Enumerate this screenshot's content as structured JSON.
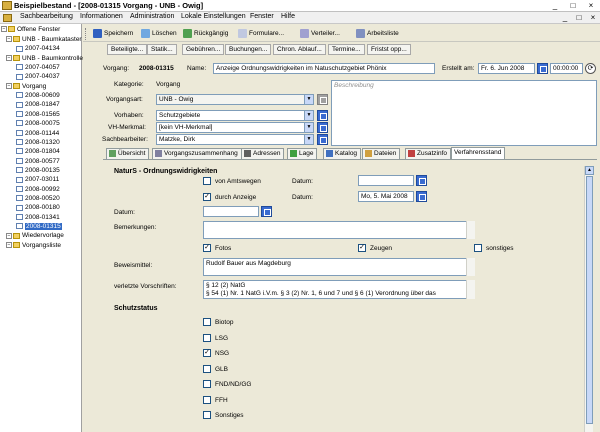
{
  "window": {
    "title": "Beispielbestand - [2008-01315 Vorgang - UNB - Owig]",
    "controls": [
      "_",
      "□",
      "×"
    ]
  },
  "menu": [
    "Sachbearbeitung",
    "Informationen",
    "Administration",
    "Lokale Einstellungen",
    "Fenster",
    "Hilfe"
  ],
  "tree": {
    "root": "Offene Fenster",
    "items": [
      {
        "label": "UNB - Baumkataster",
        "level": 1
      },
      {
        "label": "2007-04134",
        "level": 2
      },
      {
        "label": "UNB - Baumkontrolle",
        "level": 1
      },
      {
        "label": "2007-04057",
        "level": 2
      },
      {
        "label": "2007-04037",
        "level": 2
      },
      {
        "label": "Vorgang",
        "level": 1
      },
      {
        "label": "2008-00609",
        "level": 2
      },
      {
        "label": "2008-01847",
        "level": 2
      },
      {
        "label": "2008-01565",
        "level": 2
      },
      {
        "label": "2008-00075",
        "level": 2
      },
      {
        "label": "2008-01144",
        "level": 2
      },
      {
        "label": "2008-01320",
        "level": 2
      },
      {
        "label": "2008-01804",
        "level": 2
      },
      {
        "label": "2008-00577",
        "level": 2
      },
      {
        "label": "2008-00135",
        "level": 2
      },
      {
        "label": "2007-03011",
        "level": 2
      },
      {
        "label": "2008-00992",
        "level": 2
      },
      {
        "label": "2008-00520",
        "level": 2
      },
      {
        "label": "2008-00180",
        "level": 2
      },
      {
        "label": "2008-01341",
        "level": 2
      },
      {
        "label": "2008-01315",
        "level": 2,
        "selected": true
      },
      {
        "label": "Wiedervorlage",
        "level": 1
      },
      {
        "label": "Vorgangsliste",
        "level": 1
      }
    ]
  },
  "toolbar": {
    "save": "Speichern",
    "delete": "Löschen",
    "undo": "Rückgängig",
    "forms": "Formulare...",
    "distribute": "Verteiler...",
    "worklist": "Arbeitsliste"
  },
  "toolbar2": [
    "Beteiligte...",
    "Statik...",
    "Gebühren...",
    "Buchungen...",
    "Chron. Ablauf...",
    "Termine...",
    "Fristst opp..."
  ],
  "header": {
    "vorgang_label": "Vorgang:",
    "vorgang_value": "2008-01315",
    "name_label": "Name:",
    "name_value": "Anzeige Ordnungswidrigkeiten im Natuschutzgebiet Phönix",
    "created_label": "Erstellt am:",
    "created_date": "Fr. 6. Jun 2008",
    "created_time": "00:00:00"
  },
  "details": {
    "kategorie_label": "Kategorie:",
    "kategorie_value": "Vorgang",
    "vorgangsart_label": "Vorgangsart:",
    "vorgangsart_value": "UNB - Owig",
    "vorhaben_label": "Vorhaben:",
    "vorhaben_value": "Schutzgebiete",
    "vh_merkmal_label": "VH-Merkmal:",
    "vh_merkmal_value": "[kein VH-Merkmal]",
    "sachbearbeiter_label": "Sachbearbeiter:",
    "sachbearbeiter_value": "Matzke, Dirk",
    "beschreibung_placeholder": "Beschreibung"
  },
  "tabs": [
    "Übersicht",
    "Vorgangszusammenhang",
    "Adressen",
    "Lage",
    "Katalog",
    "Dateien",
    "Zusatzinfo",
    "Verfahrensstand"
  ],
  "verfahren": {
    "title": "NaturS - Ordnungswidrigkeiten",
    "von_amtswegen": "von Amtswegen",
    "durch_anzeige": "durch Anzeige",
    "datum_label": "Datum:",
    "datum_anzeige": "Mo, 5. Mai 2008",
    "datum_label2": "Datum:",
    "bemerkungen_label": "Bemerkungen:",
    "fotos": "Fotos",
    "zeugen": "Zeugen",
    "sonstiges": "sonstiges",
    "beweismittel_label": "Beweismittel:",
    "beweismittel_value": "Rudolf Bauer aus Magdeburg",
    "vorschriften_label": "verletzte Vorschriften:",
    "vorschriften_line1": "§ 12 (2) NatG",
    "vorschriften_line2": "§ 54 (1) Nr. 1 NatG i.V.m. § 3 (2) Nr. 1, 6 und 7 und § 6 (1) Verordnung  über das"
  },
  "schutzstatus": {
    "title": "Schutzstatus",
    "items": [
      {
        "label": "Biotop",
        "checked": false
      },
      {
        "label": "LSG",
        "checked": false
      },
      {
        "label": "NSG",
        "checked": true
      },
      {
        "label": "GLB",
        "checked": false
      },
      {
        "label": "FND/ND/GG",
        "checked": false
      },
      {
        "label": "FFH",
        "checked": false
      },
      {
        "label": "Sonstiges",
        "checked": false
      }
    ]
  },
  "colors": {
    "selection": "#316ac5",
    "window_bg": "#ece9d8",
    "field_border": "#7f9db9"
  }
}
